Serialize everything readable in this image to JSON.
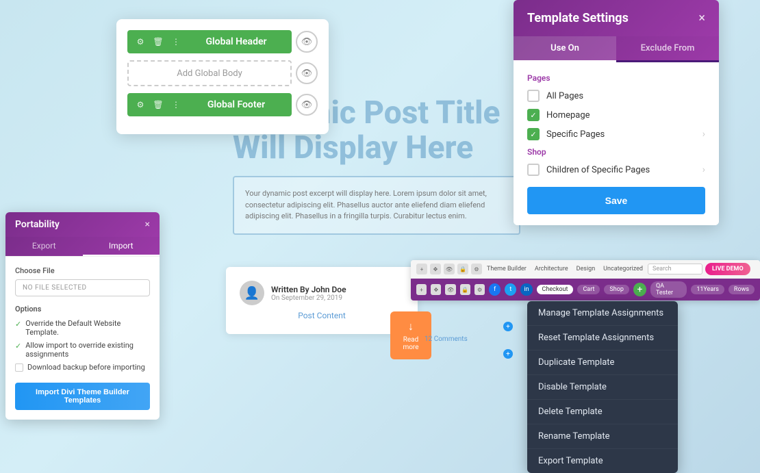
{
  "canvas": {
    "bg": "gradient"
  },
  "builder_card": {
    "rows": [
      {
        "type": "green",
        "label": "Global Header",
        "icons": [
          "gear",
          "trash",
          "dots"
        ]
      },
      {
        "type": "dashed",
        "label": "Add Global Body"
      },
      {
        "type": "green",
        "label": "Global Footer",
        "icons": [
          "gear",
          "trash",
          "dots"
        ]
      }
    ]
  },
  "dynamic_area": {
    "title": "Dynamic Post Title Will Display Here",
    "body_text": "Your dynamic post excerpt will display here. Lorem ipsum dolor sit amet, consectetur adipiscing elit. Phasellus auctor ante eliefend diam eliefend adipiscing elit. Phasellus in a fringilla turpis. Curabitur lectus enim."
  },
  "post_card": {
    "author": "Written By John Doe",
    "date": "On September 29, 2019",
    "content_link": "Post Content"
  },
  "read_more": {
    "arrow": "↓",
    "label": "Read more"
  },
  "comments": {
    "label": "12 Comments"
  },
  "portability": {
    "title": "Portability",
    "close": "×",
    "tabs": [
      "Export",
      "Import"
    ],
    "active_tab": "Import",
    "file_label": "Choose File",
    "file_placeholder": "NO FILE SELECTED",
    "options_label": "Options",
    "options": [
      {
        "checked": true,
        "label": "Override the Default Website Template."
      },
      {
        "checked": true,
        "label": "Allow import to override existing assignments"
      },
      {
        "checked": false,
        "label": "Download backup before importing"
      }
    ],
    "import_btn": "Import Divi Theme Builder Templates"
  },
  "template_settings": {
    "title": "Template Settings",
    "close": "×",
    "tabs": [
      {
        "label": "Use On",
        "active": true
      },
      {
        "label": "Exclude From",
        "active": false
      }
    ],
    "pages_section": "Pages",
    "items": [
      {
        "checked": false,
        "label": "All Pages",
        "has_chevron": false
      },
      {
        "checked": true,
        "label": "Homepage",
        "has_chevron": false
      },
      {
        "checked": true,
        "label": "Specific Pages",
        "has_chevron": true
      }
    ],
    "shop_section": "Shop",
    "shop_items": [
      {
        "checked": false,
        "label": "Children of Specific Pages",
        "has_chevron": true
      }
    ],
    "save_btn": "Save"
  },
  "context_menu": {
    "items": [
      "Manage Template Assignments",
      "Reset Template Assignments",
      "Duplicate Template",
      "Disable Template",
      "Delete Template",
      "Rename Template",
      "Export Template"
    ]
  },
  "mini_toolbar": {
    "nav_items": [
      "Theme Builder",
      "Architecture",
      "Design",
      "Uncategorized"
    ],
    "search_placeholder": "Search",
    "live_demo": "LIVE DEMO",
    "nav_pills": [
      "Checkout",
      "Cart",
      "Shop",
      "QA Tester",
      "11Years",
      "Rows"
    ],
    "social": [
      "f",
      "t",
      "in"
    ]
  }
}
